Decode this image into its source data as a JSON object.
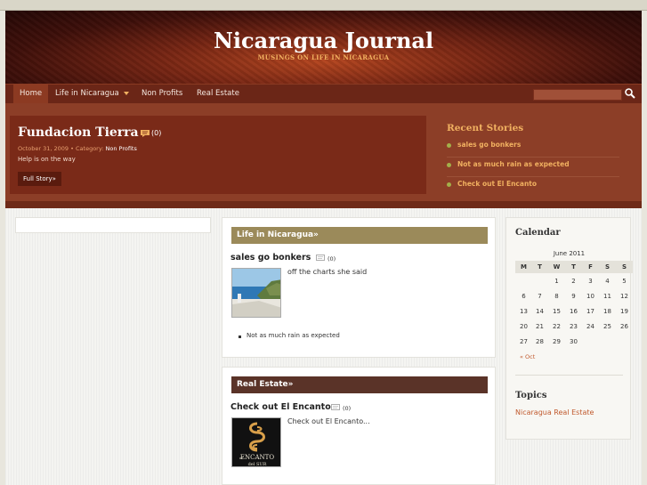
{
  "site": {
    "title": "Nicaragua Journal",
    "tagline": "MUSINGS ON LIFE IN NICARAGUA"
  },
  "nav": {
    "items": [
      "Home",
      "Life in Nicaragua",
      "Non Profits",
      "Real Estate"
    ],
    "search_value": ""
  },
  "featured": {
    "title": "Fundacion Tierra",
    "comment_count": "(0)",
    "date": "October 31, 2009",
    "meta_sep": " • Category: ",
    "category": "Non Profits",
    "excerpt": "Help is on the way",
    "button_label": "Full Story»"
  },
  "recent": {
    "title": "Recent Stories",
    "items": [
      "sales go bonkers",
      "Not as much rain as expected",
      "Check out El Encanto"
    ]
  },
  "sections": {
    "life": {
      "heading": "Life in Nicaragua»",
      "post_title": "sales go bonkers",
      "comment_count": "(0)",
      "excerpt": "off the charts she said",
      "list": [
        "Not as much rain as expected"
      ]
    },
    "real_estate": {
      "heading": "Real Estate»",
      "post_title": "Check out El Encanto",
      "comment_count": "(0)",
      "excerpt": "Check out El Encanto...",
      "logo_text": "ENCANTO",
      "logo_prefix": "el",
      "logo_suffix": "del SUR"
    }
  },
  "calendar": {
    "title": "Calendar",
    "caption": "June 2011",
    "weekdays": [
      "M",
      "T",
      "W",
      "T",
      "F",
      "S",
      "S"
    ],
    "days": [
      "",
      "",
      "1",
      "2",
      "3",
      "4",
      "5",
      "6",
      "7",
      "8",
      "9",
      "10",
      "11",
      "12",
      "13",
      "14",
      "15",
      "16",
      "17",
      "18",
      "19",
      "20",
      "21",
      "22",
      "23",
      "24",
      "25",
      "26",
      "27",
      "28",
      "29",
      "30"
    ],
    "prev_label": "« Oct"
  },
  "topics": {
    "title": "Topics",
    "items": [
      "Nicaragua Real Estate"
    ]
  },
  "colors": {
    "accent": "#f0b060",
    "header_dark": "#6b2617",
    "life_heading": "#9b8a5a",
    "real_estate_heading": "#5a3328",
    "link": "#c15a2e"
  }
}
